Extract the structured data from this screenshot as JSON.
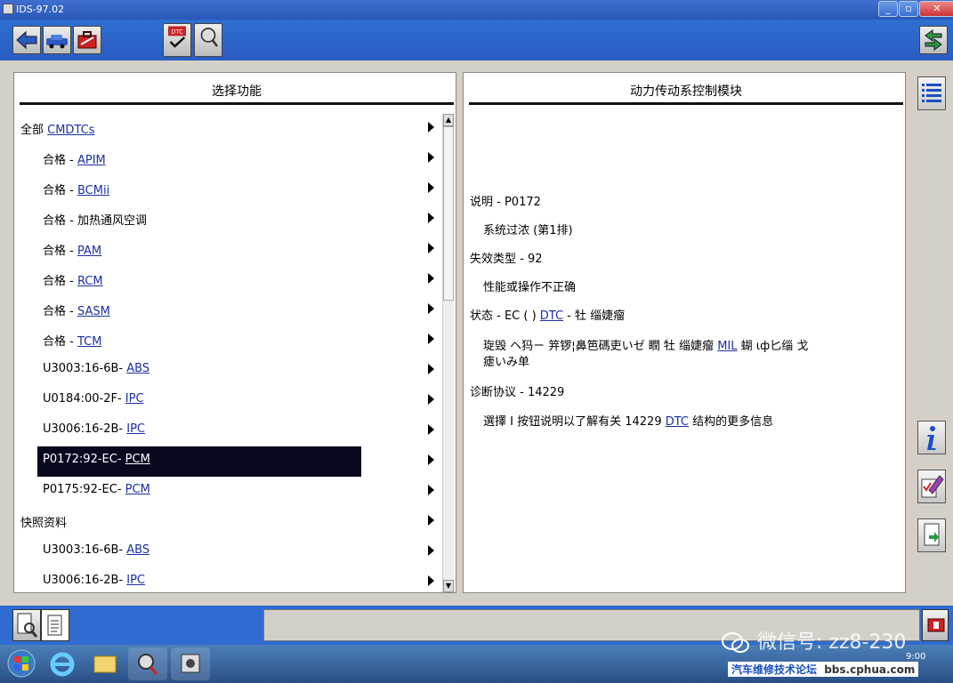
{
  "window": {
    "title": "IDS-97.02"
  },
  "left_panel": {
    "title": "选择功能",
    "items": [
      {
        "prefix": "全部 ",
        "link": "CMDTCs",
        "indent": false,
        "selected": false
      },
      {
        "prefix": "合格 - ",
        "link": "APIM",
        "indent": true,
        "selected": false
      },
      {
        "prefix": "合格 - ",
        "link": "BCMii",
        "indent": true,
        "selected": false
      },
      {
        "prefix": "合格 - 加热通风空调",
        "link": "",
        "indent": true,
        "selected": false
      },
      {
        "prefix": "合格 - ",
        "link": "PAM",
        "indent": true,
        "selected": false
      },
      {
        "prefix": "合格 - ",
        "link": "RCM",
        "indent": true,
        "selected": false
      },
      {
        "prefix": "合格 - ",
        "link": "SASM",
        "indent": true,
        "selected": false
      },
      {
        "prefix": "合格 - ",
        "link": "TCM",
        "indent": true,
        "selected": false
      },
      {
        "prefix": "U3003:16-6B- ",
        "link": "ABS",
        "indent": true,
        "selected": false
      },
      {
        "prefix": "U0184:00-2F- ",
        "link": "IPC",
        "indent": true,
        "selected": false
      },
      {
        "prefix": "U3006:16-2B- ",
        "link": "IPC",
        "indent": true,
        "selected": false
      },
      {
        "prefix": "P0172:92-EC- ",
        "link": "PCM",
        "indent": true,
        "selected": true
      },
      {
        "prefix": "P0175:92-EC- ",
        "link": "PCM",
        "indent": true,
        "selected": false
      },
      {
        "prefix": "快照资料",
        "link": "",
        "indent": false,
        "selected": false
      },
      {
        "prefix": "U3003:16-6B- ",
        "link": "ABS",
        "indent": true,
        "selected": false
      },
      {
        "prefix": "U3006:16-2B- ",
        "link": "IPC",
        "indent": true,
        "selected": false
      }
    ]
  },
  "right_panel": {
    "title": "动力传动系控制模块",
    "desc_label": "说明 - P0172",
    "desc_value": "系统过浓 (第1排)",
    "failure_label": "失效类型 - 92",
    "failure_value": "性能或操作不正确",
    "status_prefix": "状态 - EC (   ) ",
    "status_link": "DTC",
    "status_suffix": " - 牡   缁婕瘤",
    "garble_1": "琁毁  ヘ犸ㄧ     笄锣¦鼻笆碼吏いゼ   瞤   牡   缁婕瘤 ",
    "garble_link": "MIL",
    "garble_2": "  蝴   ιф匕缁   戈",
    "garble_line2": "瘧いみ单",
    "protocol_label": "诊断协议 - 14229",
    "protocol_prefix": "選擇 I 按钮说明以了解有关 14229 ",
    "protocol_link": "DTC",
    "protocol_suffix": " 结构的更多信息"
  },
  "toolbar": {
    "dtc_label": "DTC"
  },
  "watermark": {
    "wechat": "微信号: zz8-230",
    "forum": "汽车维修技术论坛",
    "site": "bbs.cphua.com",
    "clock": "9:00"
  }
}
